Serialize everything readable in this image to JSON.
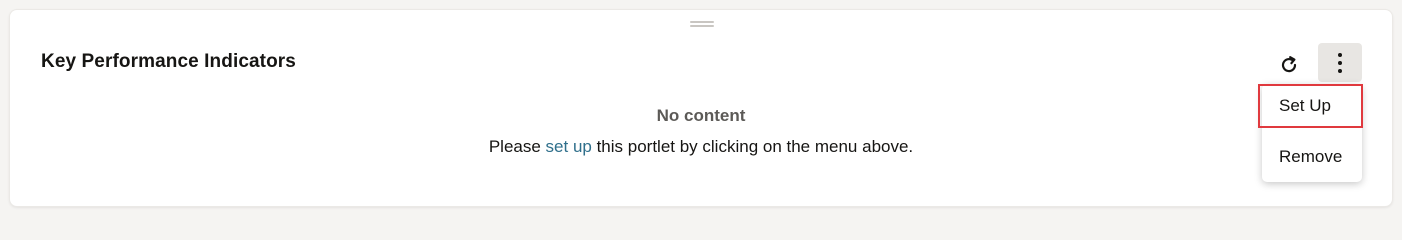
{
  "portlet": {
    "title": "Key Performance Indicators",
    "empty_title": "No content",
    "empty_msg_before": "Please ",
    "empty_msg_link": "set up",
    "empty_msg_after": " this portlet by clicking on the menu above."
  },
  "toolbar": {
    "refresh_icon": "refresh-icon",
    "menu_icon": "more-vertical-icon"
  },
  "menu": {
    "items": [
      {
        "label": "Set Up"
      },
      {
        "label": "Remove"
      }
    ]
  },
  "colors": {
    "link": "#2f6f8b",
    "highlight_border": "#e0393e",
    "menu_button_bg": "#e8e6e3"
  }
}
